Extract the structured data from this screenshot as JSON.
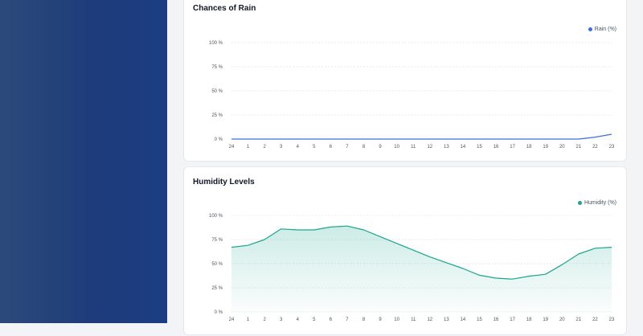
{
  "colors": {
    "rain": "#3b6fe0",
    "humidity": "#1aa68f",
    "grid": "#d1d5db"
  },
  "charts": {
    "rain": {
      "title": "Chances of Rain",
      "legend": "Rain (%)"
    },
    "humidity": {
      "title": "Humidity Levels",
      "legend": "Humidity (%)"
    }
  },
  "chart_data": [
    {
      "type": "line",
      "title": "Chances of Rain",
      "categories": [
        "24",
        "1",
        "2",
        "3",
        "4",
        "5",
        "6",
        "7",
        "8",
        "9",
        "10",
        "11",
        "12",
        "13",
        "14",
        "15",
        "16",
        "17",
        "18",
        "19",
        "20",
        "21",
        "22",
        "23"
      ],
      "series": [
        {
          "name": "Rain (%)",
          "values": [
            0,
            0,
            0,
            0,
            0,
            0,
            0,
            0,
            0,
            0,
            0,
            0,
            0,
            0,
            0,
            0,
            0,
            0,
            0,
            0,
            0,
            0,
            2,
            5
          ]
        }
      ],
      "yticks": [
        "0 %",
        "25 %",
        "50 %",
        "75 %",
        "100 %"
      ],
      "ylim": [
        0,
        100
      ],
      "grid": true,
      "legend_position": "top-right"
    },
    {
      "type": "area",
      "title": "Humidity Levels",
      "categories": [
        "24",
        "1",
        "2",
        "3",
        "4",
        "5",
        "6",
        "7",
        "8",
        "9",
        "10",
        "11",
        "12",
        "13",
        "14",
        "15",
        "16",
        "17",
        "18",
        "19",
        "20",
        "21",
        "22",
        "23"
      ],
      "series": [
        {
          "name": "Humidity (%)",
          "values": [
            67,
            69,
            75,
            86,
            85,
            85,
            88,
            89,
            85,
            78,
            71,
            64,
            57,
            51,
            45,
            38,
            35,
            34,
            37,
            39,
            49,
            60,
            66,
            67
          ]
        }
      ],
      "yticks": [
        "0 %",
        "25 %",
        "50 %",
        "75 %",
        "100 %"
      ],
      "ylim": [
        0,
        100
      ],
      "grid": true,
      "legend_position": "top-right"
    }
  ]
}
